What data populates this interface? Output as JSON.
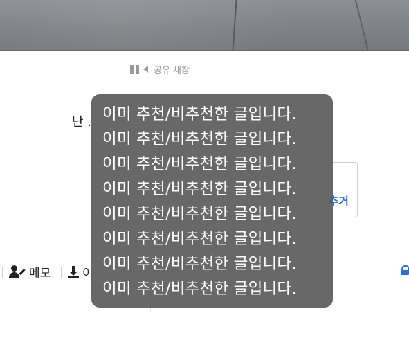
{
  "player": {
    "label": "공유 새창"
  },
  "post": {
    "body_text": "난 ."
  },
  "recommend": {
    "label": "추거"
  },
  "toolbar": {
    "memo_label": "메모",
    "download_label": "이"
  },
  "toast": {
    "messages": [
      "이미 추천/비추천한 글입니다.",
      "이미 추천/비추천한 글입니다.",
      "이미 추천/비추천한 글입니다.",
      "이미 추천/비추천한 글입니다.",
      "이미 추천/비추천한 글입니다.",
      "이미 추천/비추천한 글입니다.",
      "이미 추천/비추천한 글입니다.",
      "이미 추천/비추천한 글입니다."
    ]
  },
  "colors": {
    "accent": "#2a6fd6",
    "toast_bg": "#5a5a5a"
  },
  "icons": [
    "pause-icon",
    "volume-icon",
    "memo-icon",
    "download-icon",
    "lock-icon"
  ]
}
